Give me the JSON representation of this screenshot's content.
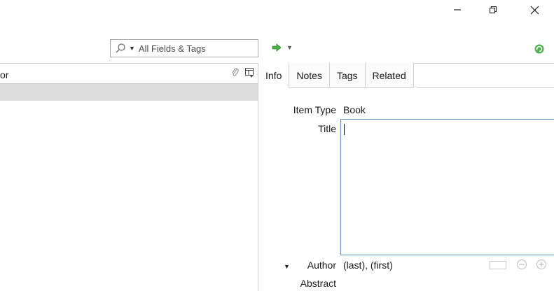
{
  "window": {
    "minimize_glyph": "—",
    "maximize_glyph": "❐",
    "close_glyph": "✕"
  },
  "toolbar": {
    "search_icon": "search-icon",
    "search_mode": "All Fields & Tags",
    "locate_icon": "locate-arrow-icon",
    "sync_icon": "sync-icon"
  },
  "items_pane": {
    "column_header_partial": "or",
    "attachment_column_icon": "paperclip-icon",
    "column_picker_icon": "column-picker-icon"
  },
  "tabs": [
    {
      "label": "Info",
      "active": true
    },
    {
      "label": "Notes",
      "active": false
    },
    {
      "label": "Tags",
      "active": false
    },
    {
      "label": "Related",
      "active": false
    }
  ],
  "info": {
    "item_type_label": "Item Type",
    "item_type_value": "Book",
    "title_label": "Title",
    "title_value": "",
    "author_label": "Author",
    "author_value": "(last), (first)",
    "abstract_label": "Abstract"
  },
  "colors": {
    "accent_green": "#3aa33a",
    "focus_blue": "#5b8fbf",
    "selection_gray": "#dcdcdc"
  }
}
